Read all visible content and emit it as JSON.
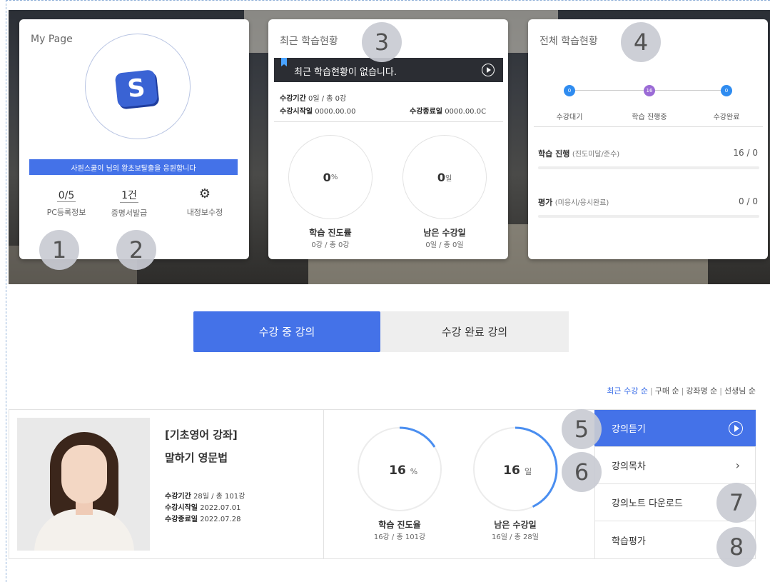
{
  "mypage": {
    "title": "My Page",
    "logo_letter": "S",
    "banner": "사원스쿨이 님의 왕초보탈출을 응원합니다",
    "stats": [
      {
        "value": "0/5",
        "label": "PC등록정보"
      },
      {
        "value": "1건",
        "label": "증명서발급"
      },
      {
        "label": "내정보수정",
        "icon": "gear-icon"
      }
    ]
  },
  "recent": {
    "title": "최근 학습현황",
    "notice": "최근 학습현황이 없습니다.",
    "period": {
      "label": "수강기간",
      "value": "0일 / 총 0강"
    },
    "start": {
      "label": "수강시작일",
      "value": "0000.00.00"
    },
    "end": {
      "label": "수강종료일",
      "value": "0000.00.0C"
    },
    "progress": {
      "value": "0",
      "unit": "%",
      "title": "학습 진도률",
      "sub": "0강 / 총 0강"
    },
    "remain": {
      "value": "0",
      "unit": "일",
      "title": "남은 수강일",
      "sub": "0일 / 총 0일"
    }
  },
  "overall": {
    "title": "전체 학습현황",
    "steps": [
      {
        "count": "0",
        "label": "수강대기",
        "color": "#2f8cf0"
      },
      {
        "count": "16",
        "label": "학습 진행중",
        "color": "#9b6bd6"
      },
      {
        "count": "0",
        "label": "수강완료",
        "color": "#2f8cf0"
      }
    ],
    "rows": [
      {
        "title": "학습 진행",
        "sub": "(진도미달/준수)",
        "value": "16 / 0"
      },
      {
        "title": "평가",
        "sub": "(미응시/응시완료)",
        "value": "0 / 0"
      }
    ]
  },
  "tabs": {
    "active": "수강 중 강의",
    "done": "수강 완료 강의"
  },
  "sort": {
    "items": [
      "최근 수강 순",
      "구매 순",
      "강좌명 순",
      "선생님 순"
    ],
    "separator": "|"
  },
  "course": {
    "title1": "[기초영어 강좌]",
    "title2": "말하기 영문법",
    "period_label": "수강기간",
    "period": "28일 / 총 101강",
    "start_label": "수강시작일",
    "start": "2022.07.01",
    "end_label": "수강종료일",
    "end": "2022.07.28",
    "progress": {
      "value": "16",
      "unit": "%",
      "title": "학습 진도율",
      "sub": "16강 / 총 101강",
      "fraction": 0.16
    },
    "remain": {
      "value": "16",
      "unit": "일",
      "title": "남은 수강일",
      "sub": "16일 / 총 28일",
      "fraction": 0.43
    },
    "accent": "#4472e8"
  },
  "menu": [
    "강의듣기",
    "강의목차",
    "강의노트 다운로드",
    "학습평가"
  ],
  "badges": [
    "1",
    "2",
    "3",
    "4",
    "5",
    "6",
    "7",
    "8"
  ]
}
